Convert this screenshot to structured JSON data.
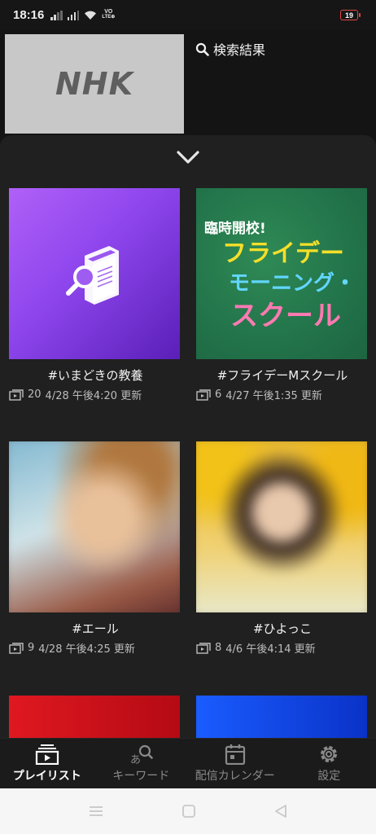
{
  "status_bar": {
    "time": "18:16",
    "network_label_top": "VO",
    "network_label_bottom": "LTE⊕",
    "battery": "19"
  },
  "header": {
    "thumbnail_logo": "NHK",
    "search_result_label": "検索結果"
  },
  "playlists": [
    {
      "title": "#いまどきの教養",
      "count": "20",
      "updated": "4/28 午後4:20 更新",
      "thumb": "book-search-icon"
    },
    {
      "title": "#フライデーMスクール",
      "count": "6",
      "updated": "4/27 午後1:35 更新",
      "thumb_lines": [
        "臨時開校!",
        "フライデー",
        "モーニング・",
        "スクール"
      ]
    },
    {
      "title": "#エール",
      "count": "9",
      "updated": "4/28 午後4:25 更新"
    },
    {
      "title": "#ひよっこ",
      "count": "8",
      "updated": "4/6 午後4:14 更新"
    }
  ],
  "bottom_nav": {
    "items": [
      {
        "label": "プレイリスト",
        "icon": "playlist-icon",
        "active": true
      },
      {
        "label": "キーワード",
        "icon": "keyword-search-icon",
        "active": false
      },
      {
        "label": "配信カレンダー",
        "icon": "calendar-icon",
        "active": false
      },
      {
        "label": "設定",
        "icon": "gear-icon",
        "active": false
      }
    ]
  },
  "colors": {
    "background": "#141414",
    "sheet": "#202020",
    "accent_purple": "#8d45ec",
    "battery_low": "#e04646"
  }
}
